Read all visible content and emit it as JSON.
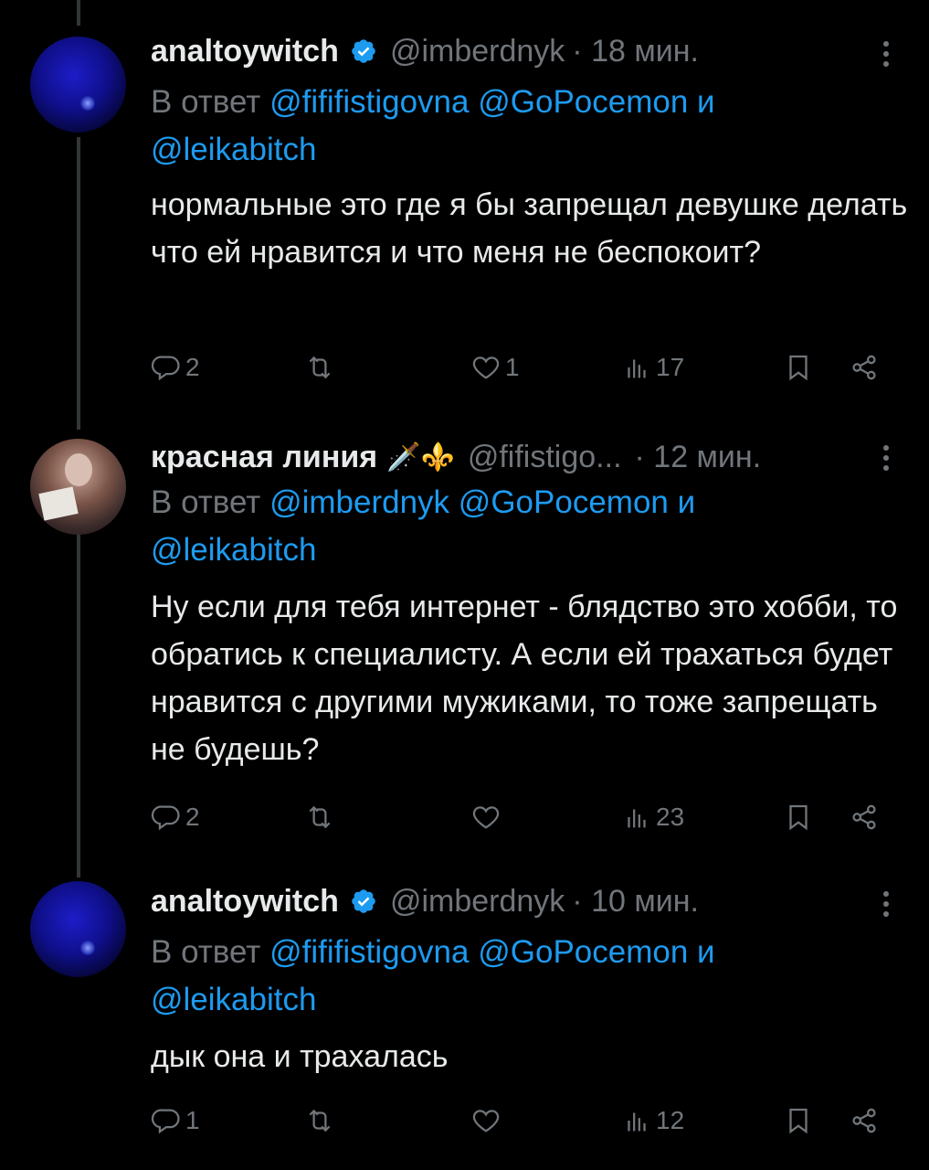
{
  "colors": {
    "background": "#000000",
    "text": "#e7e9ea",
    "muted": "#71767b",
    "link": "#1d9bf0",
    "verified": "#1d9bf0"
  },
  "tweets": [
    {
      "name": "analtoywitch",
      "verified": true,
      "handle": "@imberdnyk",
      "time": "· 18 мин.",
      "reply_prefix": "В ответ",
      "mention1": "@fififistigovna",
      "mention2": "@GoPocemon",
      "conj": "и",
      "mention3": "@leikabitch",
      "text": "нормальные это где я бы запрещал девушке делать что ей нравится и что меня не беспокоит?",
      "replies": "2",
      "retweets": "",
      "likes": "1",
      "views": "17"
    },
    {
      "name": "красная линия",
      "emoji": "🗡️⚜️",
      "handle": "@fifistigo...",
      "time": "· 12 мин.",
      "reply_prefix": "В ответ",
      "mention1": "@imberdnyk",
      "mention2": "@GoPocemon",
      "conj": "и",
      "mention3": "@leikabitch",
      "text": "Ну если для тебя интернет - блядство это хобби, то обратись к специалисту. А если ей трахаться будет нравится с другими мужиками, то тоже запрещать не будешь?",
      "replies": "2",
      "retweets": "",
      "likes": "",
      "views": "23"
    },
    {
      "name": "analtoywitch",
      "verified": true,
      "handle": "@imberdnyk",
      "time": "· 10 мин.",
      "reply_prefix": "В ответ",
      "mention1": "@fififistigovna",
      "mention2": "@GoPocemon",
      "conj": "и",
      "mention3": "@leikabitch",
      "text": "дык она и трахалась",
      "replies": "1",
      "retweets": "",
      "likes": "",
      "views": "12"
    }
  ]
}
